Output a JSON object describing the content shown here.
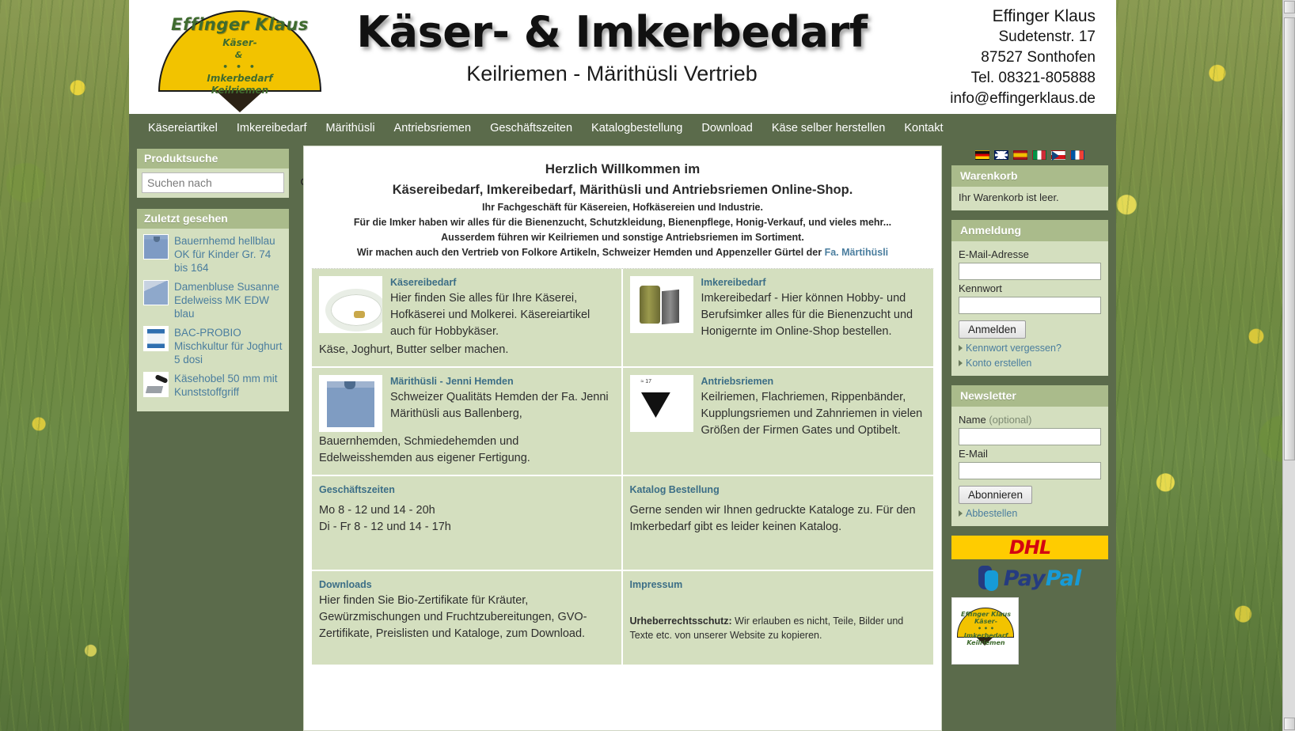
{
  "site": {
    "logo": {
      "arc_text": "Effinger Klaus",
      "line1": "Käser-",
      "dots1": "• • •",
      "amp": "&",
      "dots2": "• • •",
      "line3": "Imkerbedarf",
      "line4": "Keilriemen",
      "brand_yellow": "#f2c300",
      "brand_green": "#3f6b2f"
    },
    "title": "Käser- & Imkerbedarf",
    "subtitle": "Keilriemen - Märithüsli Vertrieb"
  },
  "contact": {
    "name": "Effinger Klaus",
    "street": "Sudetenstr. 17",
    "city": "87527 Sonthofen",
    "phone": "Tel. 08321-805888",
    "email": "info@effingerklaus.de"
  },
  "nav": {
    "items": [
      {
        "label": "Käsereiartikel"
      },
      {
        "label": "Imkereibedarf"
      },
      {
        "label": "Märithüsli"
      },
      {
        "label": "Antriebsriemen"
      },
      {
        "label": "Geschäftszeiten"
      },
      {
        "label": "Katalogbestellung"
      },
      {
        "label": "Download"
      },
      {
        "label": "Käse selber herstellen"
      },
      {
        "label": "Kontakt"
      }
    ]
  },
  "sidebar_left": {
    "search": {
      "title": "Produktsuche",
      "placeholder": "Suchen nach",
      "value": "",
      "icon": "search-icon"
    },
    "recent": {
      "title": "Zuletzt gesehen",
      "items": [
        {
          "label": "Bauernhemd hellblau OK für Kinder Gr. 74 bis 164",
          "thumb": "shirt-thumb"
        },
        {
          "label": "Damenbluse Susanne Edelweiss MK EDW blau",
          "thumb": "blouse-thumb"
        },
        {
          "label": "BAC-PROBIO Mischkultur für Joghurt 5 dosi",
          "thumb": "culture-bag-thumb"
        },
        {
          "label": "Käsehobel 50 mm mit Kunststoffgriff",
          "thumb": "cheese-plane-thumb"
        }
      ]
    }
  },
  "main": {
    "welcome": {
      "line1": "Herzlich Willkommen im",
      "line2": "Käsereibedarf, Imkereibedarf, Märithüsli und Antriebsriemen Online-Shop.",
      "line3": "Ihr Fachgeschäft für Käsereien, Hofkäsereien und Industrie.",
      "line4": "Für die Imker haben wir alles für die Bienenzucht, Schutzkleidung, Bienenpflege, Honig-Verkauf, und vieles mehr...",
      "line5": "Ausserdem führen wir Keilriemen und sonstige Antriebsriemen im Sortiment.",
      "line6_prefix": "Wir machen auch den Vertrieb von Folkore Artikeln, Schweizer Hemden und Appenzeller Gürtel der ",
      "line6_link": "Fa. Märtihüsli"
    },
    "cards": [
      {
        "title": "Käsereibedarf",
        "thumb": "cheese-mould-thumb",
        "text": "Hier finden Sie alles für Ihre Käserei, Hofkäserei und Molkerei. Käsereiartikel auch für Hobbykäser.",
        "text_wide": "Käse, Joghurt, Butter selber machen."
      },
      {
        "title": "Imkereibedarf",
        "thumb": "bee-smoker-thumb",
        "text": "Imkereibedarf - Hier können Hobby- und Berufsimker alles für die Bienenzucht und Honigernte im Online-Shop bestellen.",
        "text_wide": ""
      },
      {
        "title": "Märithüsli - Jenni Hemden",
        "thumb": "jenni-shirt-thumb",
        "text": "Schweizer Qualitäts Hemden der Fa. Jenni Märithüsli aus Ballenberg,",
        "text_wide": "Bauernhemden, Schmiedehemden und Edelweisshemden aus eigener Fertigung."
      },
      {
        "title": "Antriebsriemen",
        "thumb": "v-belt-thumb",
        "thumb_label": "≈ 17",
        "text": "Keilriemen, Flachriemen, Rippenbänder, Kupplungsriemen und Zahnriemen in vielen Größen der Firmen Gates und Optibelt.",
        "text_wide": ""
      },
      {
        "title": "Geschäftszeiten",
        "thumb": "",
        "text": "Mo 8 - 12  und 14 - 20h",
        "text_wide": "Di - Fr 8 - 12 und 14 - 17h"
      },
      {
        "title": "Katalog Bestellung",
        "thumb": "",
        "text": "Gerne senden wir Ihnen gedruckte Kataloge zu. Für den Imkerbedarf gibt es leider keinen Katalog.",
        "text_wide": ""
      },
      {
        "title": "Downloads",
        "thumb": "",
        "text": "Hier finden Sie Bio-Zertifikate für Kräuter, Gewürzmischungen und Fruchtzubereitungen, GVO-Zertifikate, Preislisten und Kataloge,  zum Download.",
        "text_wide": ""
      },
      {
        "title": "Impressum",
        "thumb": "",
        "text_bold": "Urheberrechtsschutz:",
        "text": " Wir erlauben es nicht, Teile, Bilder und Texte etc. von unserer Website zu kopieren.",
        "text_wide": ""
      }
    ]
  },
  "sidebar_right": {
    "languages": [
      {
        "name": "german-flag",
        "class": "f-de"
      },
      {
        "name": "uk-flag",
        "class": "f-gb"
      },
      {
        "name": "spanish-flag",
        "class": "f-es"
      },
      {
        "name": "italian-flag",
        "class": "f-it"
      },
      {
        "name": "czech-flag",
        "class": "f-cz"
      },
      {
        "name": "french-flag",
        "class": "f-fr"
      }
    ],
    "cart": {
      "title": "Warenkorb",
      "empty_text": "Ihr Warenkorb ist leer."
    },
    "login": {
      "title": "Anmeldung",
      "email_label": "E-Mail-Adresse",
      "email_value": "",
      "password_label": "Kennwort",
      "password_value": "",
      "submit_label": "Anmelden",
      "forgot_link": "Kennwort vergessen?",
      "create_link": "Konto erstellen"
    },
    "newsletter": {
      "title": "Newsletter",
      "name_label": "Name",
      "name_optional": "(optional)",
      "name_value": "",
      "email_label": "E-Mail",
      "email_value": "",
      "submit_label": "Abonnieren",
      "unsubscribe_link": "Abbestellen"
    },
    "badges": {
      "dhl_label": "DHL",
      "paypal_pay": "Pay",
      "paypal_pal": "Pal",
      "shop_logo_arc": "Effinger Klaus",
      "shop_logo_l1": "Käser-",
      "shop_logo_l2": "• • •",
      "shop_logo_l3": "Imkerbedarf",
      "shop_logo_l4": "Keilriemen"
    }
  }
}
